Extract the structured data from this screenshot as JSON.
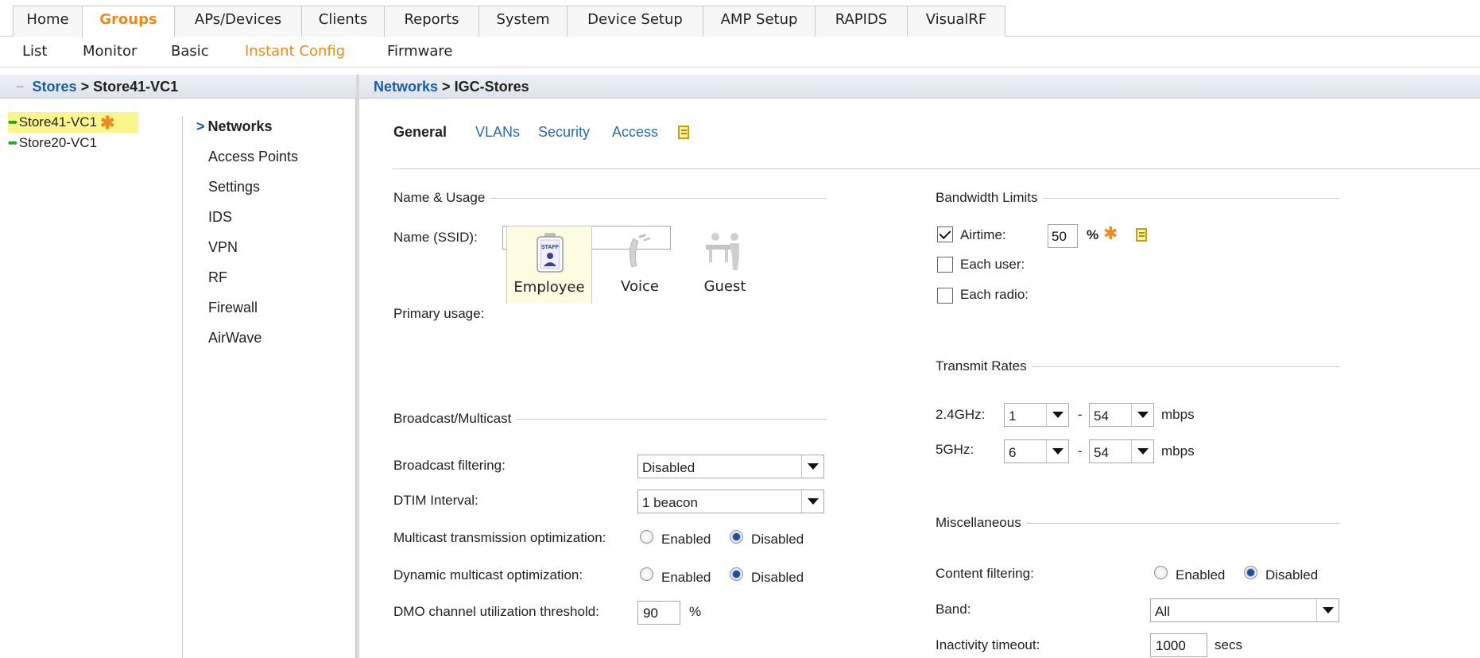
{
  "topnav": {
    "tabs": [
      {
        "label": "Home"
      },
      {
        "label": "Groups"
      },
      {
        "label": "APs/Devices"
      },
      {
        "label": "Clients"
      },
      {
        "label": "Reports"
      },
      {
        "label": "System"
      },
      {
        "label": "Device Setup"
      },
      {
        "label": "AMP Setup"
      },
      {
        "label": "RAPIDS"
      },
      {
        "label": "VisualRF"
      }
    ],
    "active": "Groups"
  },
  "subnav": {
    "items": [
      {
        "label": "List"
      },
      {
        "label": "Monitor"
      },
      {
        "label": "Basic"
      },
      {
        "label": "Instant Config"
      },
      {
        "label": "Firmware"
      }
    ],
    "active": "Instant Config"
  },
  "left": {
    "collapse_icon": "−",
    "breadcrumb_link": "Stores",
    "breadcrumb_sep": ">",
    "breadcrumb_current": "Store41-VC1",
    "tree": [
      {
        "label": "Store41-VC1",
        "selected": true,
        "modified": true
      },
      {
        "label": "Store20-VC1",
        "selected": false,
        "modified": false
      }
    ],
    "menu": [
      {
        "label": "Networks",
        "active": true
      },
      {
        "label": "Access Points"
      },
      {
        "label": "Settings"
      },
      {
        "label": "IDS"
      },
      {
        "label": "VPN"
      },
      {
        "label": "RF"
      },
      {
        "label": "Firewall"
      },
      {
        "label": "AirWave"
      }
    ]
  },
  "right": {
    "breadcrumb_link": "Networks",
    "breadcrumb_sep": ">",
    "breadcrumb_current": "IGC-Stores",
    "tabs": [
      {
        "label": "General",
        "active": true
      },
      {
        "label": "VLANs"
      },
      {
        "label": "Security"
      },
      {
        "label": "Access"
      }
    ],
    "name_usage": {
      "title": "Name & Usage",
      "name_label": "Name (SSID):",
      "name_value": "IGC-Stores",
      "usage_label": "Primary usage:",
      "usage_options": [
        {
          "label": "Employee",
          "icon": "staff-badge-icon",
          "selected": true
        },
        {
          "label": "Voice",
          "icon": "phone-icon",
          "selected": false
        },
        {
          "label": "Guest",
          "icon": "guest-desk-icon",
          "selected": false
        }
      ],
      "badge_text": "STAFF"
    },
    "broadcast": {
      "title": "Broadcast/Multicast",
      "filtering_label": "Broadcast filtering:",
      "filtering_value": "Disabled",
      "dtim_label": "DTIM Interval:",
      "dtim_value": "1 beacon",
      "mto_label": "Multicast transmission optimization:",
      "mto_value": "Disabled",
      "dmo_label": "Dynamic multicast optimization:",
      "dmo_value": "Disabled",
      "enabled_label": "Enabled",
      "disabled_label": "Disabled",
      "threshold_label": "DMO channel utilization threshold:",
      "threshold_value": "90",
      "threshold_unit": "%"
    },
    "bandwidth": {
      "title": "Bandwidth Limits",
      "airtime_label": "Airtime:",
      "airtime_checked": true,
      "airtime_value": "50",
      "airtime_unit": "%",
      "each_user_label": "Each user:",
      "each_user_checked": false,
      "each_radio_label": "Each radio:",
      "each_radio_checked": false
    },
    "transmit": {
      "title": "Transmit Rates",
      "rows": [
        {
          "label": "2.4GHz:",
          "min": "1",
          "max": "54",
          "unit": "mbps"
        },
        {
          "label": "5GHz:",
          "min": "6",
          "max": "54",
          "unit": "mbps"
        }
      ],
      "dash": "-"
    },
    "misc": {
      "title": "Miscellaneous",
      "content_label": "Content filtering:",
      "content_value": "Disabled",
      "enabled_label": "Enabled",
      "disabled_label": "Disabled",
      "band_label": "Band:",
      "band_value": "All",
      "inactivity_label": "Inactivity timeout:",
      "inactivity_value": "1000",
      "inactivity_unit": "secs"
    }
  },
  "colors": {
    "accent": "#f08a1c",
    "link": "#2a6ab8",
    "selected_tree": "#fbf68b",
    "status_dots": "#22a322"
  }
}
